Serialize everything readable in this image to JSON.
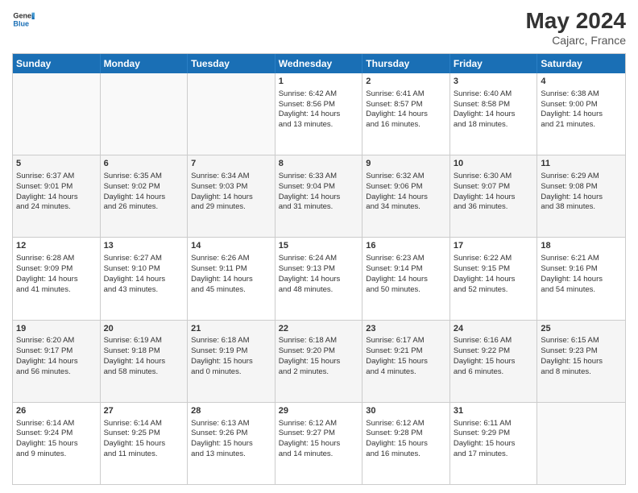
{
  "header": {
    "logo_general": "General",
    "logo_blue": "Blue",
    "month_year": "May 2024",
    "location": "Cajarc, France"
  },
  "weekdays": [
    "Sunday",
    "Monday",
    "Tuesday",
    "Wednesday",
    "Thursday",
    "Friday",
    "Saturday"
  ],
  "rows": [
    [
      {
        "day": "",
        "info": ""
      },
      {
        "day": "",
        "info": ""
      },
      {
        "day": "",
        "info": ""
      },
      {
        "day": "1",
        "info": "Sunrise: 6:42 AM\nSunset: 8:56 PM\nDaylight: 14 hours\nand 13 minutes."
      },
      {
        "day": "2",
        "info": "Sunrise: 6:41 AM\nSunset: 8:57 PM\nDaylight: 14 hours\nand 16 minutes."
      },
      {
        "day": "3",
        "info": "Sunrise: 6:40 AM\nSunset: 8:58 PM\nDaylight: 14 hours\nand 18 minutes."
      },
      {
        "day": "4",
        "info": "Sunrise: 6:38 AM\nSunset: 9:00 PM\nDaylight: 14 hours\nand 21 minutes."
      }
    ],
    [
      {
        "day": "5",
        "info": "Sunrise: 6:37 AM\nSunset: 9:01 PM\nDaylight: 14 hours\nand 24 minutes."
      },
      {
        "day": "6",
        "info": "Sunrise: 6:35 AM\nSunset: 9:02 PM\nDaylight: 14 hours\nand 26 minutes."
      },
      {
        "day": "7",
        "info": "Sunrise: 6:34 AM\nSunset: 9:03 PM\nDaylight: 14 hours\nand 29 minutes."
      },
      {
        "day": "8",
        "info": "Sunrise: 6:33 AM\nSunset: 9:04 PM\nDaylight: 14 hours\nand 31 minutes."
      },
      {
        "day": "9",
        "info": "Sunrise: 6:32 AM\nSunset: 9:06 PM\nDaylight: 14 hours\nand 34 minutes."
      },
      {
        "day": "10",
        "info": "Sunrise: 6:30 AM\nSunset: 9:07 PM\nDaylight: 14 hours\nand 36 minutes."
      },
      {
        "day": "11",
        "info": "Sunrise: 6:29 AM\nSunset: 9:08 PM\nDaylight: 14 hours\nand 38 minutes."
      }
    ],
    [
      {
        "day": "12",
        "info": "Sunrise: 6:28 AM\nSunset: 9:09 PM\nDaylight: 14 hours\nand 41 minutes."
      },
      {
        "day": "13",
        "info": "Sunrise: 6:27 AM\nSunset: 9:10 PM\nDaylight: 14 hours\nand 43 minutes."
      },
      {
        "day": "14",
        "info": "Sunrise: 6:26 AM\nSunset: 9:11 PM\nDaylight: 14 hours\nand 45 minutes."
      },
      {
        "day": "15",
        "info": "Sunrise: 6:24 AM\nSunset: 9:13 PM\nDaylight: 14 hours\nand 48 minutes."
      },
      {
        "day": "16",
        "info": "Sunrise: 6:23 AM\nSunset: 9:14 PM\nDaylight: 14 hours\nand 50 minutes."
      },
      {
        "day": "17",
        "info": "Sunrise: 6:22 AM\nSunset: 9:15 PM\nDaylight: 14 hours\nand 52 minutes."
      },
      {
        "day": "18",
        "info": "Sunrise: 6:21 AM\nSunset: 9:16 PM\nDaylight: 14 hours\nand 54 minutes."
      }
    ],
    [
      {
        "day": "19",
        "info": "Sunrise: 6:20 AM\nSunset: 9:17 PM\nDaylight: 14 hours\nand 56 minutes."
      },
      {
        "day": "20",
        "info": "Sunrise: 6:19 AM\nSunset: 9:18 PM\nDaylight: 14 hours\nand 58 minutes."
      },
      {
        "day": "21",
        "info": "Sunrise: 6:18 AM\nSunset: 9:19 PM\nDaylight: 15 hours\nand 0 minutes."
      },
      {
        "day": "22",
        "info": "Sunrise: 6:18 AM\nSunset: 9:20 PM\nDaylight: 15 hours\nand 2 minutes."
      },
      {
        "day": "23",
        "info": "Sunrise: 6:17 AM\nSunset: 9:21 PM\nDaylight: 15 hours\nand 4 minutes."
      },
      {
        "day": "24",
        "info": "Sunrise: 6:16 AM\nSunset: 9:22 PM\nDaylight: 15 hours\nand 6 minutes."
      },
      {
        "day": "25",
        "info": "Sunrise: 6:15 AM\nSunset: 9:23 PM\nDaylight: 15 hours\nand 8 minutes."
      }
    ],
    [
      {
        "day": "26",
        "info": "Sunrise: 6:14 AM\nSunset: 9:24 PM\nDaylight: 15 hours\nand 9 minutes."
      },
      {
        "day": "27",
        "info": "Sunrise: 6:14 AM\nSunset: 9:25 PM\nDaylight: 15 hours\nand 11 minutes."
      },
      {
        "day": "28",
        "info": "Sunrise: 6:13 AM\nSunset: 9:26 PM\nDaylight: 15 hours\nand 13 minutes."
      },
      {
        "day": "29",
        "info": "Sunrise: 6:12 AM\nSunset: 9:27 PM\nDaylight: 15 hours\nand 14 minutes."
      },
      {
        "day": "30",
        "info": "Sunrise: 6:12 AM\nSunset: 9:28 PM\nDaylight: 15 hours\nand 16 minutes."
      },
      {
        "day": "31",
        "info": "Sunrise: 6:11 AM\nSunset: 9:29 PM\nDaylight: 15 hours\nand 17 minutes."
      },
      {
        "day": "",
        "info": ""
      }
    ]
  ]
}
